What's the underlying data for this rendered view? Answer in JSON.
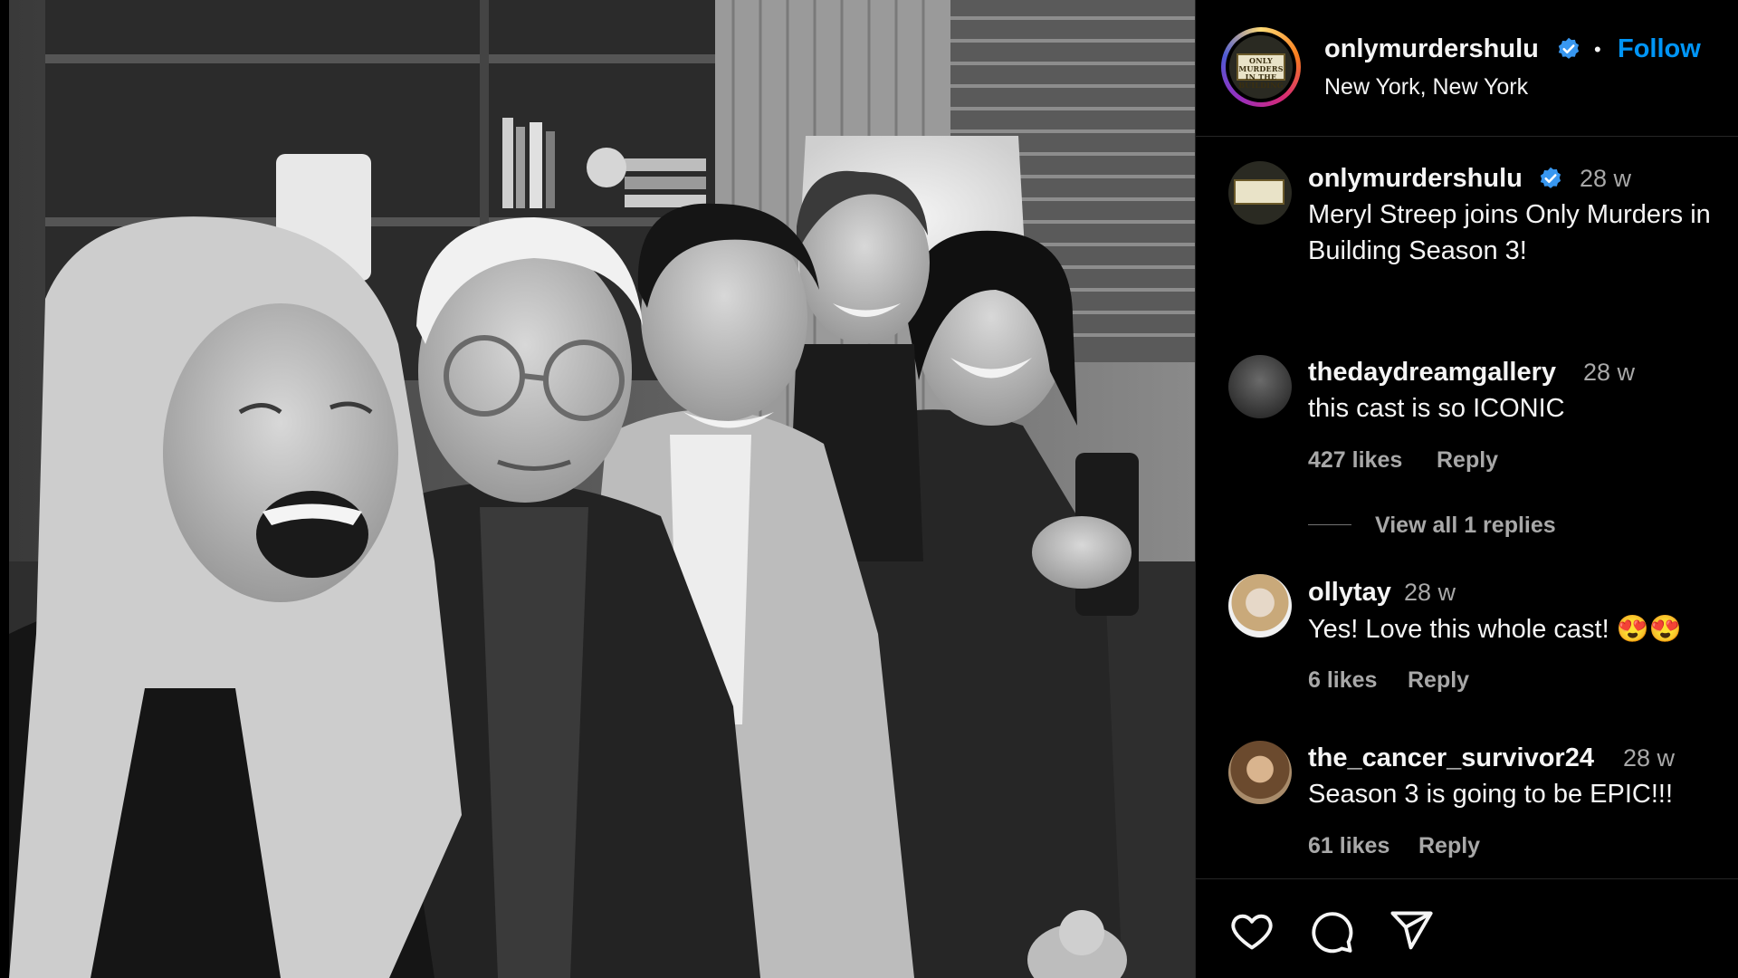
{
  "post": {
    "account": "onlymurdershulu",
    "separator": "•",
    "follow_label": "Follow",
    "location": "New York, New York",
    "logo_text": "ONLY MURDERS IN THE BUILDING"
  },
  "caption": {
    "username": "onlymurdershulu",
    "time": "28 w",
    "line1": "Meryl Streep joins Only Murders in",
    "line2": "Building Season 3!"
  },
  "comments": [
    {
      "username": "thedaydreamgallery",
      "time": "28 w",
      "text": "this cast is so ICONIC",
      "likes": "427 likes",
      "reply_label": "Reply",
      "view_replies": "View all 1 replies"
    },
    {
      "username": "ollytay",
      "time": "28 w",
      "text": "Yes! Love this whole cast! 😍😍",
      "likes": "6 likes",
      "reply_label": "Reply"
    },
    {
      "username": "the_cancer_survivor24",
      "time": "28 w",
      "text": "Season 3 is going to be EPIC!!!",
      "likes": "61 likes",
      "reply_label": "Reply"
    }
  ],
  "actions": [
    "heart-icon",
    "comment-icon",
    "share-icon"
  ],
  "colors": {
    "accent": "#0095f6",
    "verified": "#3897f0",
    "muted": "#a8a8a8",
    "divider": "#262626"
  }
}
